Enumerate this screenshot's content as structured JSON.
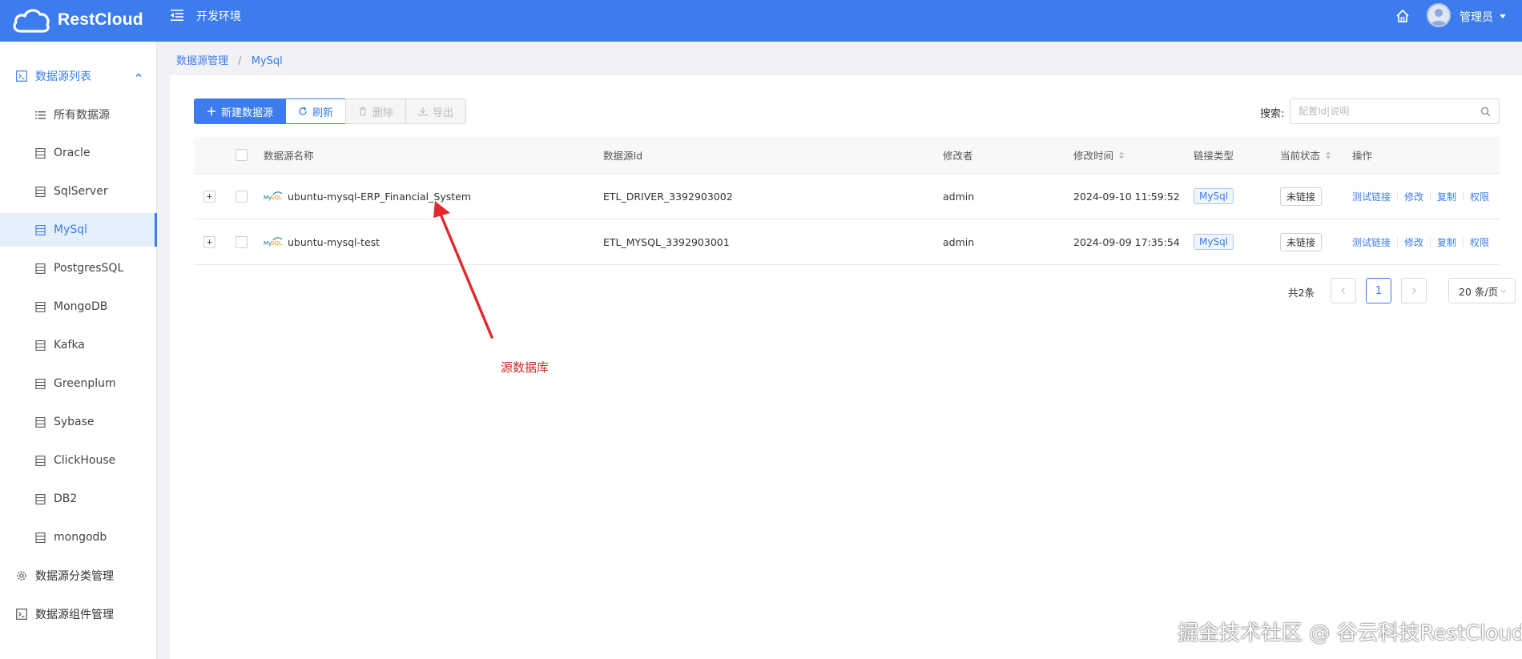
{
  "header": {
    "brand": "RestCloud",
    "env_title": "开发环境",
    "user_name": "管理员",
    "brand_color": "#3c7ced"
  },
  "sidebar": {
    "group_datasource_list": "数据源列表",
    "items": [
      {
        "label": "所有数据源",
        "icon": "list-icon"
      },
      {
        "label": "Oracle",
        "icon": "database-icon"
      },
      {
        "label": "SqlServer",
        "icon": "database-icon"
      },
      {
        "label": "MySql",
        "icon": "database-icon",
        "active": true
      },
      {
        "label": "PostgresSQL",
        "icon": "database-icon"
      },
      {
        "label": "MongoDB",
        "icon": "database-icon"
      },
      {
        "label": "Kafka",
        "icon": "database-icon"
      },
      {
        "label": "Greenplum",
        "icon": "database-icon"
      },
      {
        "label": "Sybase",
        "icon": "database-icon"
      },
      {
        "label": "ClickHouse",
        "icon": "database-icon"
      },
      {
        "label": "DB2",
        "icon": "database-icon"
      },
      {
        "label": "mongodb",
        "icon": "database-icon"
      }
    ],
    "group_category": "数据源分类管理",
    "group_component": "数据源组件管理"
  },
  "breadcrumb": {
    "root": "数据源管理",
    "separator": "/",
    "current": "MySql"
  },
  "toolbar": {
    "new_label": "新建数据源",
    "refresh_label": "刷新",
    "delete_label": "删除",
    "export_label": "导出"
  },
  "search": {
    "label": "搜索:",
    "placeholder": "配置Id|说明",
    "value": ""
  },
  "table": {
    "columns": {
      "name": "数据源名称",
      "id": "数据源Id",
      "modifier": "修改者",
      "modified_time": "修改时间",
      "link_type": "链接类型",
      "status": "当前状态",
      "actions": "操作"
    },
    "rows": [
      {
        "name": "ubuntu-mysql-ERP_Financial_System",
        "id": "ETL_DRIVER_3392903002",
        "modifier": "admin",
        "modified_time": "2024-09-10 11:59:52",
        "link_type": "MySql",
        "status": "未链接"
      },
      {
        "name": "ubuntu-mysql-test",
        "id": "ETL_MYSQL_3392903001",
        "modifier": "admin",
        "modified_time": "2024-09-09 17:35:54",
        "link_type": "MySql",
        "status": "未链接"
      }
    ],
    "actions": {
      "test": "测试链接",
      "edit": "修改",
      "copy": "复制",
      "permission": "权限"
    },
    "expand_symbol": "+"
  },
  "pagination": {
    "total": "共2条",
    "current_page": "1",
    "page_size": "20 条/页"
  },
  "annotation": {
    "text": "源数据库",
    "color": "#d3282b"
  },
  "watermark": "掘金技术社区 @ 谷云科技RestCloud"
}
